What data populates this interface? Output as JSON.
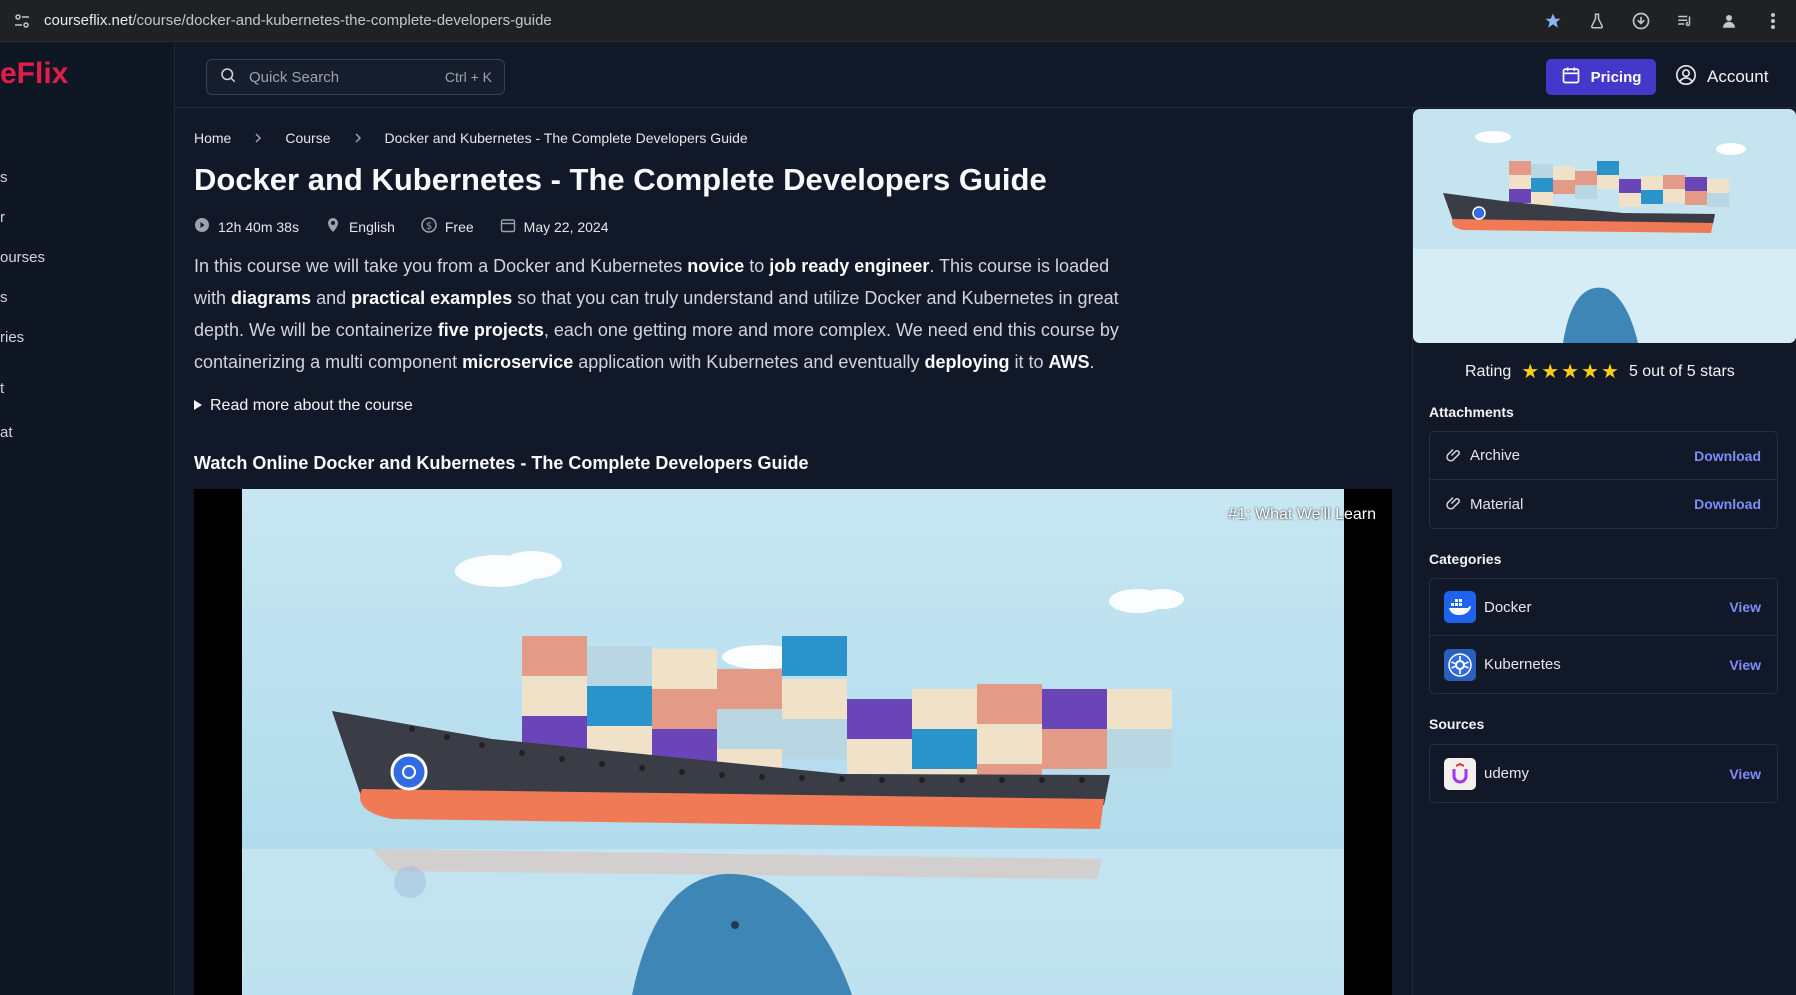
{
  "browser": {
    "url_host": "courseflix.net",
    "url_path": "/course/docker-and-kubernetes-the-complete-developers-guide"
  },
  "brand": {
    "logo_text": "eFlix",
    "accent": "#e11d48"
  },
  "sidebar": {
    "items": [
      {
        "label": "s"
      },
      {
        "label": "r"
      },
      {
        "label": "ourses"
      },
      {
        "label": "s"
      },
      {
        "label": "ries"
      },
      {
        "label": "t"
      },
      {
        "label": "at"
      }
    ]
  },
  "topbar": {
    "search_placeholder": "Quick Search",
    "search_shortcut": "Ctrl + K",
    "pricing_label": "Pricing",
    "account_label": "Account",
    "pricing_color": "#4338ca"
  },
  "breadcrumb": {
    "items": [
      "Home",
      "Course",
      "Docker and Kubernetes - The Complete Developers Guide"
    ]
  },
  "course": {
    "title": "Docker and Kubernetes - The Complete Developers Guide",
    "duration": "12h 40m 38s",
    "language": "English",
    "price": "Free",
    "date": "May 22, 2024",
    "description": [
      {
        "t": "In this course we will take you from a Docker and Kubernetes ",
        "b": false
      },
      {
        "t": "novice",
        "b": true
      },
      {
        "t": " to ",
        "b": false
      },
      {
        "t": "job ready engineer",
        "b": true
      },
      {
        "t": ". This course is loaded with ",
        "b": false
      },
      {
        "t": "diagrams",
        "b": true
      },
      {
        "t": " and ",
        "b": false
      },
      {
        "t": "practical examples",
        "b": true
      },
      {
        "t": " so that you can truly understand and utilize Docker and Kubernetes in great depth. We will be containerize ",
        "b": false
      },
      {
        "t": "five projects",
        "b": true
      },
      {
        "t": ", each one getting more and more complex. We need end this course by containerizing a multi component ",
        "b": false
      },
      {
        "t": "microservice",
        "b": true
      },
      {
        "t": " application with Kubernetes and eventually ",
        "b": false
      },
      {
        "t": "deploying",
        "b": true
      },
      {
        "t": " it to ",
        "b": false
      },
      {
        "t": "AWS",
        "b": true
      },
      {
        "t": ".",
        "b": false
      }
    ],
    "read_more": "Read more about the course",
    "watch_title": "Watch Online Docker and Kubernetes - The Complete Developers Guide",
    "video_lesson": "#1: What We'll Learn"
  },
  "rating": {
    "label": "Rating",
    "stars": 5,
    "text": "5 out of 5 stars"
  },
  "attachments": {
    "title": "Attachments",
    "items": [
      {
        "label": "Archive",
        "action": "Download"
      },
      {
        "label": "Material",
        "action": "Download"
      }
    ]
  },
  "categories": {
    "title": "Categories",
    "items": [
      {
        "label": "Docker",
        "action": "View",
        "icon": "docker-logo"
      },
      {
        "label": "Kubernetes",
        "action": "View",
        "icon": "kubernetes-logo"
      }
    ]
  },
  "sources": {
    "title": "Sources",
    "items": [
      {
        "label": "udemy",
        "action": "View",
        "icon": "udemy-logo"
      }
    ]
  }
}
